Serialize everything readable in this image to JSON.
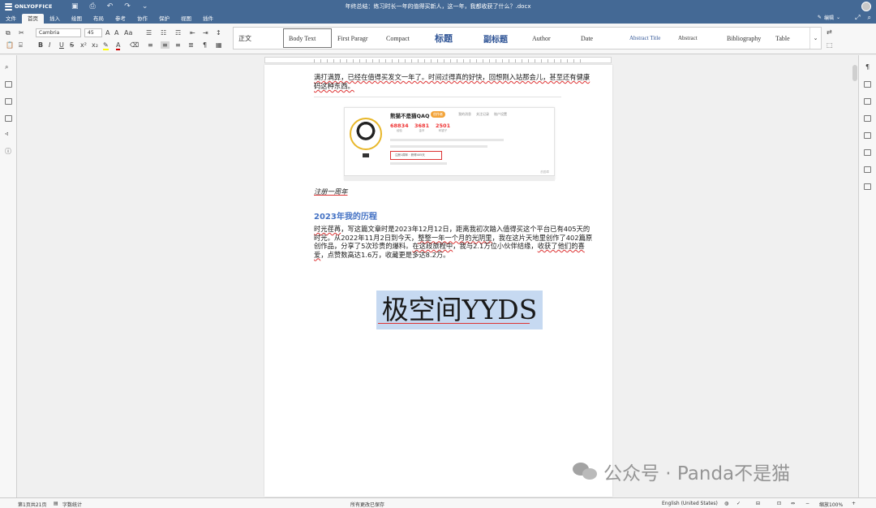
{
  "app": {
    "logo_text": "ONLYOFFICE",
    "doc_title": "年终总结：练习时长一年的值得买新人，这一年，我都收获了什么？.docx",
    "edit_mode": "编辑",
    "tabs": [
      "文件",
      "首页",
      "插入",
      "绘图",
      "布局",
      "参考",
      "协作",
      "保护",
      "视图",
      "插件"
    ],
    "active_tab": "首页"
  },
  "toolbar": {
    "font_name": "Cambria",
    "font_size": "45",
    "styles": [
      "正文",
      "Body Text",
      "First Paragr",
      "Compact",
      "标题",
      "副标题",
      "Author",
      "Date",
      "Abstract Title",
      "Abstract",
      "Bibliography",
      "Table"
    ]
  },
  "document": {
    "para1": "满打满算，已经在值得买发文一年了。时间过得真的好快，回想刚入站那会儿，甚至还有健康码这种东西。",
    "shot": {
      "name": "熊猫不是猫QAQ",
      "tag": "创作者",
      "links": [
        "我的消息",
        "关注记录",
        "账户设置"
      ],
      "stats": [
        {
          "value": "68834",
          "label": "经验"
        },
        {
          "value": "3681",
          "label": "金币"
        },
        {
          "value": "2501",
          "label": "碎银子"
        }
      ],
      "highlight": "注册1周年 · 获得405天",
      "foot": "的勋章"
    },
    "caption": "注册一周年",
    "heading": "2023年我的历程",
    "para2_a": "时光荏苒",
    "para2_b": "，写这篇文章时是2023年12月12日，距离我初次踏入值得买这个平台已有405天的时光。从2022年11月2日到今天，",
    "para2_c": "整整一年一个月的光阴里",
    "para2_d": "，我在这片天地里创作了402篇原创作品，分享了5次珍贵的爆料。",
    "para2_e": "在这段旅程中",
    "para2_f": "，我与2.1万位小伙伴结缘，",
    "para2_g": "收获了他们的喜爱",
    "para2_h": "，点赞数高达1.6万，收藏更是多达8.2万。",
    "big_text": "极空间YYDS"
  },
  "watermark": "公众号 · Panda不是猫",
  "status": {
    "page": "第1页共21页",
    "word_count": "字数统计",
    "saved": "所有更改已保存",
    "language": "English (United States)",
    "zoom": "缩放100%"
  }
}
